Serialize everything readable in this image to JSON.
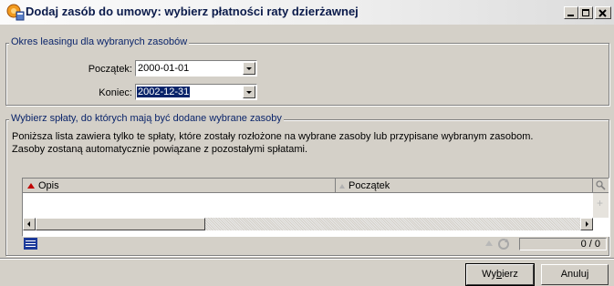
{
  "window": {
    "title": "Dodaj zasób do umowy: wybierz płatności raty dzierżawnej",
    "controls": [
      "minimize",
      "maximize",
      "close"
    ]
  },
  "lease_period": {
    "legend": "Okres leasingu dla wybranych zasobów",
    "start_label": "Początek:",
    "start_value": "2000-01-01",
    "end_label": "Koniec:",
    "end_value": "2002-12-31"
  },
  "installments": {
    "legend": "Wybierz spłaty, do których mają być dodane wybrane zasoby",
    "desc_line1": "Poniższa lista zawiera tylko te spłaty, które zostały rozłożone na wybrane zasoby lub przypisane wybranym zasobom.",
    "desc_line2": "Zasoby zostaną automatycznie powiązane z pozostałymi spłatami.",
    "columns": [
      "Opis",
      "Początek"
    ],
    "rows": [],
    "counter": "0 / 0"
  },
  "buttons": {
    "select_pre": "Wy",
    "select_underlined": "b",
    "select_post": "ierz",
    "cancel": "Anuluj"
  },
  "colors": {
    "selection": "#0a246a",
    "legend_text": "#0a246a",
    "face": "#d4d0c8"
  }
}
